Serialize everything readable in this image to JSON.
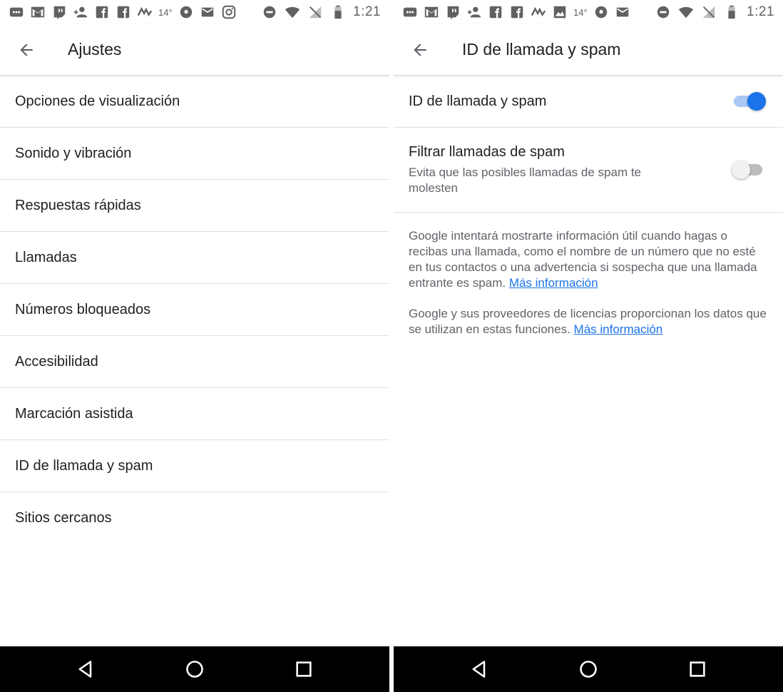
{
  "status_bar": {
    "temperature": "14°",
    "time": "1:21"
  },
  "left": {
    "title": "Ajustes",
    "items": [
      {
        "label": "Opciones de visualización"
      },
      {
        "label": "Sonido y vibración"
      },
      {
        "label": "Respuestas rápidas"
      },
      {
        "label": "Llamadas"
      },
      {
        "label": "Números bloqueados"
      },
      {
        "label": "Accesibilidad"
      },
      {
        "label": "Marcación asistida"
      },
      {
        "label": "ID de llamada y spam"
      },
      {
        "label": "Sitios cercanos"
      }
    ]
  },
  "right": {
    "title": "ID de llamada y spam",
    "caller_id": {
      "title": "ID de llamada y spam",
      "enabled": true
    },
    "filter_spam": {
      "title": "Filtrar llamadas de spam",
      "summary": "Evita que las posibles llamadas de spam te molesten",
      "enabled": false
    },
    "info1_text": "Google intentará mostrarte información útil cuando hagas o recibas una llamada, como el nombre de un número que no esté en tus contactos o una advertencia si sospecha que una llamada entrante es spam.",
    "info1_link": "Más información",
    "info2_text": "Google y sus proveedores de licencias proporcionan los datos que se utilizan en estas funciones.",
    "info2_link": "Más información"
  },
  "colors": {
    "accent": "#1a73e8",
    "text_primary": "#202124",
    "text_secondary": "#5f6368",
    "navbar": "#000000"
  }
}
